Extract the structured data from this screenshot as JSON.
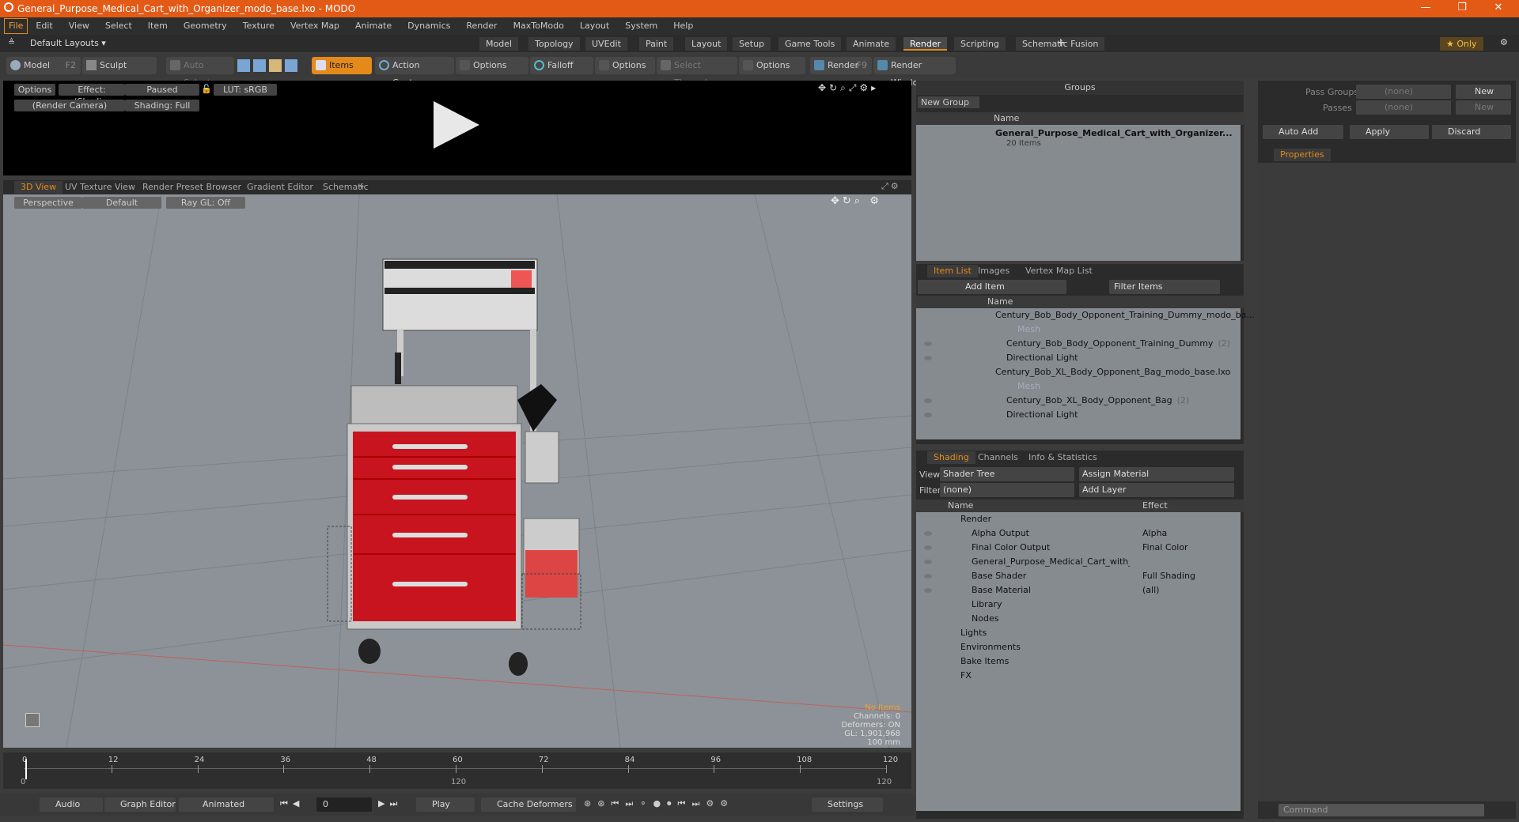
{
  "window": {
    "title": "General_Purpose_Medical_Cart_with_Organizer_modo_base.lxo - MODO"
  },
  "menu": [
    "File",
    "Edit",
    "View",
    "Select",
    "Item",
    "Geometry",
    "Texture",
    "Vertex Map",
    "Animate",
    "Dynamics",
    "Render",
    "MaxToModo",
    "Layout",
    "System",
    "Help"
  ],
  "layouts": {
    "label": "Default Layouts ▾",
    "tabs": [
      "Model",
      "Topology",
      "UVEdit",
      "Paint",
      "Layout",
      "Setup",
      "Game Tools",
      "Animate",
      "Render",
      "Scripting",
      "Schematic Fusion"
    ],
    "active": "Render",
    "only": "★ Only"
  },
  "toolbar": {
    "model": "Model",
    "model_key": "F2",
    "sculpt": "Sculpt",
    "auto_select": "Auto Select",
    "items": "Items",
    "action_center": "Action Center",
    "options1": "Options",
    "falloff": "Falloff",
    "options2": "Options",
    "select_through": "Select Through",
    "options3": "Options",
    "render": "Render",
    "render_key": "F9",
    "render_window": "Render Window"
  },
  "preview": {
    "options": "Options",
    "effect": "Effect: (Shadi...",
    "paused": "Paused",
    "lut": "LUT: sRGB",
    "camera": "(Render Camera)",
    "shading": "Shading: Full"
  },
  "viewtabs": [
    "3D View",
    "UV Texture View",
    "Render Preset Browser",
    "Gradient Editor",
    "Schematic"
  ],
  "viewport": {
    "perspective": "Perspective",
    "default": "Default",
    "raygl": "Ray GL: Off",
    "info": {
      "no_items": "No Items",
      "channels": "Channels: 0",
      "deformers": "Deformers: ON",
      "gl": "GL: 1,901,968",
      "scale": "100 mm"
    }
  },
  "timeline": {
    "ticks": [
      "0",
      "12",
      "24",
      "36",
      "48",
      "60",
      "72",
      "84",
      "96",
      "108",
      "120"
    ],
    "sub": [
      "0",
      "120",
      "120"
    ]
  },
  "bottombar": {
    "audio": "Audio",
    "graph": "Graph Editor",
    "animated": "Animated",
    "frame": "0",
    "play": "Play",
    "cache": "Cache Deformers",
    "settings": "Settings"
  },
  "groups": {
    "title": "Groups",
    "new_group": "New Group",
    "name_col": "Name",
    "item": "General_Purpose_Medical_Cart_with_Organizer...",
    "count": "20 Items"
  },
  "itemlist": {
    "tabs": [
      "Item List",
      "Images",
      "Vertex Map List"
    ],
    "add_item": "Add Item",
    "filter": "Filter Items",
    "name_col": "Name",
    "rows": [
      {
        "t": "Century_Bob_Body_Opponent_Training_Dummy_modo_ba...",
        "lvl": 0
      },
      {
        "t": "Mesh",
        "lvl": 2,
        "dim": true
      },
      {
        "t": "Century_Bob_Body_Opponent_Training_Dummy",
        "lvl": 1,
        "extra": "(2)"
      },
      {
        "t": "Directional Light",
        "lvl": 1
      },
      {
        "t": "Century_Bob_XL_Body_Opponent_Bag_modo_base.lxo",
        "lvl": 0
      },
      {
        "t": "Mesh",
        "lvl": 2,
        "dim": true
      },
      {
        "t": "Century_Bob_XL_Body_Opponent_Bag",
        "lvl": 1,
        "extra": "(2)"
      },
      {
        "t": "Directional Light",
        "lvl": 1
      }
    ]
  },
  "shading": {
    "tabs": [
      "Shading",
      "Channels",
      "Info & Statistics"
    ],
    "view_label": "View",
    "view": "Shader Tree",
    "assign": "Assign Material",
    "filter_label": "Filter",
    "filter": "(none)",
    "add_layer": "Add Layer",
    "name_col": "Name",
    "effect_col": "Effect",
    "rows": [
      {
        "t": "Render",
        "e": "",
        "lvl": 0
      },
      {
        "t": "Alpha Output",
        "e": "Alpha",
        "lvl": 1
      },
      {
        "t": "Final Color Output",
        "e": "Final Color",
        "lvl": 1
      },
      {
        "t": "General_Purpose_Medical_Cart_with_",
        "e": "",
        "lvl": 1
      },
      {
        "t": "Base Shader",
        "e": "Full Shading",
        "lvl": 1
      },
      {
        "t": "Base Material",
        "e": "(all)",
        "lvl": 1
      },
      {
        "t": "Library",
        "e": "",
        "lvl": 1
      },
      {
        "t": "Nodes",
        "e": "",
        "lvl": 1
      },
      {
        "t": "Lights",
        "e": "",
        "lvl": 0
      },
      {
        "t": "Environments",
        "e": "",
        "lvl": 0
      },
      {
        "t": "Bake Items",
        "e": "",
        "lvl": 0
      },
      {
        "t": "FX",
        "e": "",
        "lvl": 0
      }
    ]
  },
  "passes": {
    "pass_groups": "Pass Groups",
    "passes": "Passes",
    "none": "(none)",
    "new": "New",
    "auto_add": "Auto Add",
    "apply": "Apply",
    "discard": "Discard",
    "properties": "Properties"
  },
  "command": {
    "placeholder": "Command"
  }
}
